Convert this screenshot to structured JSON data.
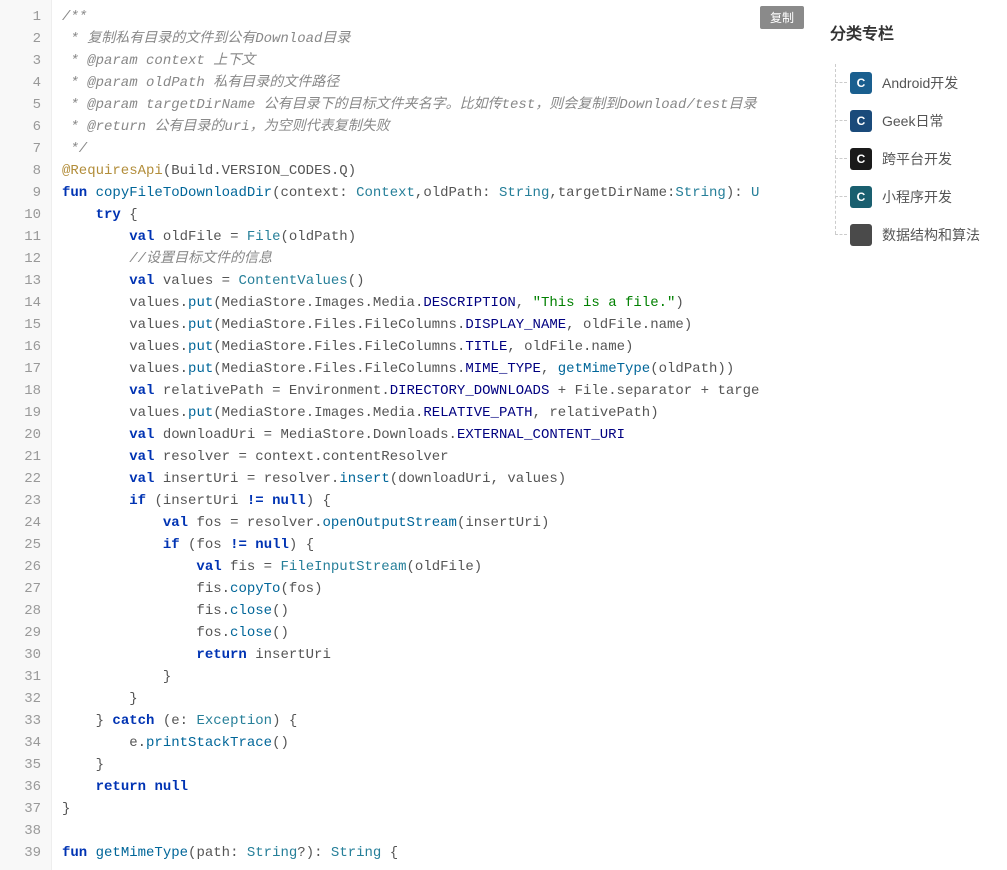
{
  "copy_button": "复制",
  "sidebar": {
    "title": "分类专栏",
    "items": [
      {
        "label": "Android开发",
        "icon_bg": "#1a5f8f",
        "icon_text": "C"
      },
      {
        "label": "Geek日常",
        "icon_bg": "#1a4a7a",
        "icon_text": "C"
      },
      {
        "label": "跨平台开发",
        "icon_bg": "#1a1a1a",
        "icon_text": "C"
      },
      {
        "label": "小程序开发",
        "icon_bg": "#1a5f6f",
        "icon_text": "C"
      },
      {
        "label": "数据结构和算法",
        "icon_bg": "#4a4a4a",
        "icon_text": ""
      }
    ]
  },
  "code": {
    "line_count": 39,
    "tokens": {
      "l1": "/**",
      "l2": " * 复制私有目录的文件到公有Download目录",
      "l3": " * @param context 上下文",
      "l4": " * @param oldPath 私有目录的文件路径",
      "l5": " * @param targetDirName 公有目录下的目标文件夹名字。比如传test，则会复制到Download/test目录",
      "l6": " * @return 公有目录的uri，为空则代表复制失败",
      "l7": " */",
      "l8_anno": "@RequiresApi",
      "l8_arg": "Build",
      "l8_arg2": "VERSION_CODES",
      "l8_arg3": "Q",
      "l9_fun": "fun",
      "l9_name": "copyFileToDownloadDir",
      "l9_p1": "context",
      "l9_t1": "Context",
      "l9_p2": "oldPath",
      "l9_t2": "String",
      "l9_p3": "targetDirName",
      "l9_t3": "String",
      "l9_ret": "U",
      "l10_try": "try",
      "l11_val": "val",
      "l11_var": "oldFile",
      "l11_file": "File",
      "l11_arg": "oldPath",
      "l12": "//设置目标文件的信息",
      "l13_val": "val",
      "l13_var": "values",
      "l13_cv": "ContentValues",
      "l14_values": "values",
      "l14_put": "put",
      "l14_ms": "MediaStore",
      "l14_img": "Images",
      "l14_med": "Media",
      "l14_desc": "DESCRIPTION",
      "l14_str": "\"This is a file.\"",
      "l15_values": "values",
      "l15_put": "put",
      "l15_ms": "MediaStore",
      "l15_files": "Files",
      "l15_fc": "FileColumns",
      "l15_dn": "DISPLAY_NAME",
      "l15_of": "oldFile",
      "l15_name": "name",
      "l16_values": "values",
      "l16_put": "put",
      "l16_ms": "MediaStore",
      "l16_files": "Files",
      "l16_fc": "FileColumns",
      "l16_title": "TITLE",
      "l16_of": "oldFile",
      "l16_name": "name",
      "l17_values": "values",
      "l17_put": "put",
      "l17_ms": "MediaStore",
      "l17_files": "Files",
      "l17_fc": "FileColumns",
      "l17_mt": "MIME_TYPE",
      "l17_gm": "getMimeType",
      "l17_op": "oldPath",
      "l18_val": "val",
      "l18_rp": "relativePath",
      "l18_env": "Environment",
      "l18_dd": "DIRECTORY_DOWNLOADS",
      "l18_file": "File",
      "l18_sep": "separator",
      "l18_targ": "targe",
      "l19_values": "values",
      "l19_put": "put",
      "l19_ms": "MediaStore",
      "l19_img": "Images",
      "l19_med": "Media",
      "l19_rp": "RELATIVE_PATH",
      "l19_rpv": "relativePath",
      "l20_val": "val",
      "l20_du": "downloadUri",
      "l20_ms": "MediaStore",
      "l20_dl": "Downloads",
      "l20_ecu": "EXTERNAL_CONTENT_URI",
      "l21_val": "val",
      "l21_res": "resolver",
      "l21_ctx": "context",
      "l21_cr": "contentResolver",
      "l22_val": "val",
      "l22_iu": "insertUri",
      "l22_res": "resolver",
      "l22_ins": "insert",
      "l22_du": "downloadUri",
      "l22_vals": "values",
      "l23_if": "if",
      "l23_iu": "insertUri",
      "l23_ne": "!=",
      "l23_null": "null",
      "l24_val": "val",
      "l24_fos": "fos",
      "l24_res": "resolver",
      "l24_oos": "openOutputStream",
      "l24_iu": "insertUri",
      "l25_if": "if",
      "l25_fos": "fos",
      "l25_ne": "!=",
      "l25_null": "null",
      "l26_val": "val",
      "l26_fis": "fis",
      "l26_FIS": "FileInputStream",
      "l26_of": "oldFile",
      "l27_fis": "fis",
      "l27_ct": "copyTo",
      "l27_fos": "fos",
      "l28_fis": "fis",
      "l28_close": "close",
      "l29_fos": "fos",
      "l29_close": "close",
      "l30_ret": "return",
      "l30_iu": "insertUri",
      "l33_catch": "catch",
      "l33_e": "e",
      "l33_ex": "Exception",
      "l34_e": "e",
      "l34_pst": "printStackTrace",
      "l36_ret": "return",
      "l36_null": "null",
      "l39_fun": "fun",
      "l39_gmt": "getMimeType",
      "l39_path": "path",
      "l39_str": "String",
      "l39_str2": "String"
    }
  }
}
